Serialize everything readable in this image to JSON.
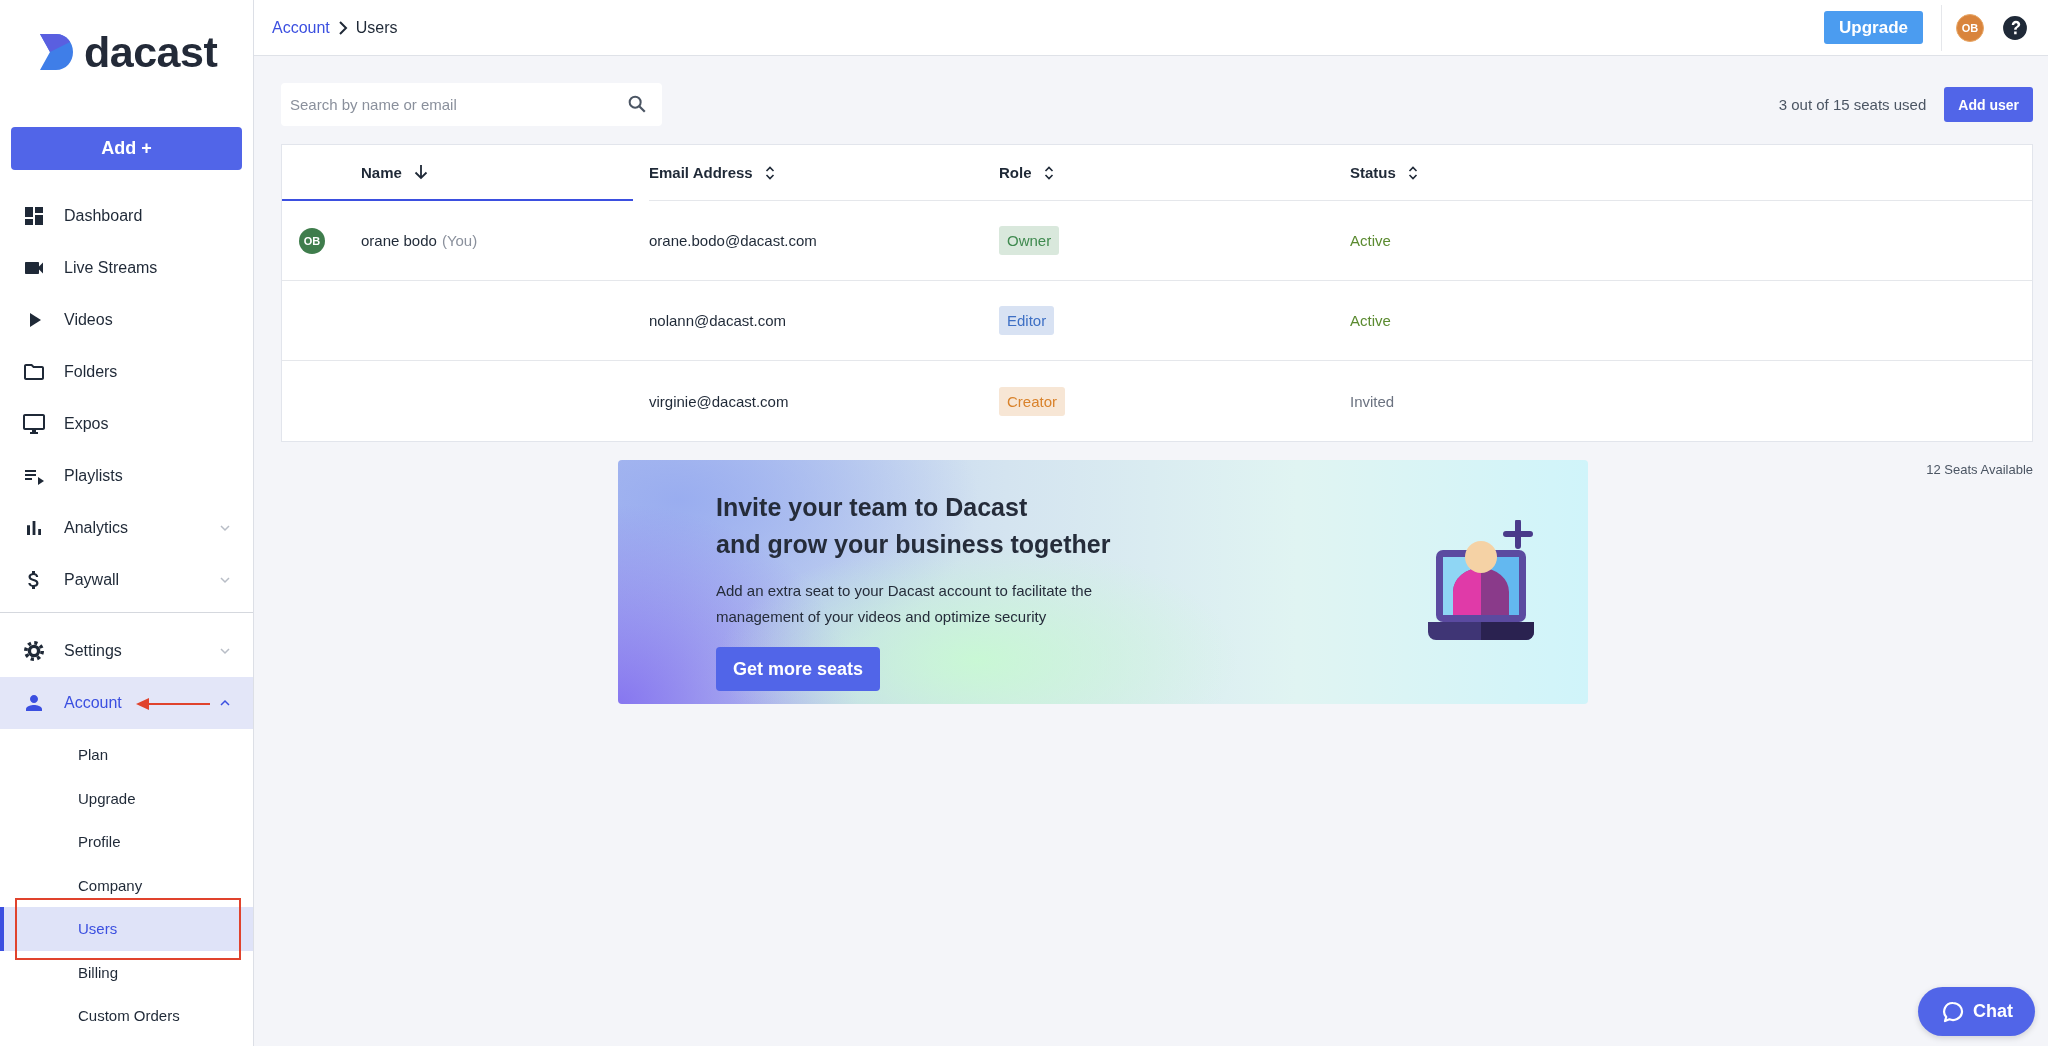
{
  "sidebar": {
    "logo": "dacast",
    "add_button": "Add +",
    "items": [
      {
        "label": "Dashboard",
        "selected": false
      },
      {
        "label": "Live Streams",
        "selected": false
      },
      {
        "label": "Videos",
        "selected": false
      },
      {
        "label": "Folders",
        "selected": false
      },
      {
        "label": "Expos",
        "selected": false
      },
      {
        "label": "Playlists",
        "selected": false
      },
      {
        "label": "Analytics",
        "selected": false,
        "expanded": false
      },
      {
        "label": "Paywall",
        "selected": false,
        "expanded": false
      }
    ],
    "bottom_items": [
      {
        "label": "Settings",
        "selected": false,
        "expanded": false
      },
      {
        "label": "Account",
        "selected": true,
        "expanded": true,
        "children": [
          {
            "label": "Plan",
            "selected": false
          },
          {
            "label": "Upgrade",
            "selected": false
          },
          {
            "label": "Profile",
            "selected": false
          },
          {
            "label": "Company",
            "selected": false
          },
          {
            "label": "Users",
            "selected": true
          },
          {
            "label": "Billing",
            "selected": false
          },
          {
            "label": "Custom Orders",
            "selected": false
          }
        ]
      }
    ]
  },
  "annotations": {
    "arrow": true,
    "frame": true
  },
  "header": {
    "breadcrumb": [
      "Account",
      "Users"
    ],
    "upgrade_button": "Upgrade",
    "avatar": "OB"
  },
  "toolbar": {
    "search": {
      "placeholder": "Search by name or email"
    },
    "seats_used": "3 out of 15 seats used",
    "add_button": "Add user"
  },
  "table": {
    "columns": [
      {
        "label": "Name",
        "sorted": true
      },
      {
        "label": "Email Address",
        "sorted": false
      },
      {
        "label": "Role",
        "sorted": false
      },
      {
        "label": "Status",
        "sorted": false
      }
    ],
    "rows": [
      {
        "avatar": "OB",
        "name": "orane bodo",
        "name_note": "(You)",
        "email": "orane.bodo@dacast.com",
        "role": {
          "text": "Owner",
          "color": "#3f8a4f"
        },
        "status": {
          "text": "Active",
          "color": "#5a8a2f"
        }
      },
      {
        "email": "nolann@dacast.com",
        "role": {
          "text": "Editor",
          "color": "#3d6fc4"
        },
        "status": {
          "text": "Active",
          "color": "#5a8a2f"
        }
      },
      {
        "email": "virginie@dacast.com",
        "role": {
          "text": "Creator",
          "color": "#d9822b"
        },
        "status": {
          "text": "Invited",
          "color": "#6b7280"
        }
      }
    ]
  },
  "seats_available": "12 Seats Available",
  "banner": {
    "title_lines": [
      "Invite your team to Dacast",
      "and grow your business together"
    ],
    "description_lines": [
      "Add an extra seat to your Dacast account to facilitate the",
      "management of your videos and optimize security"
    ],
    "button": "Get more seats"
  },
  "chat_button": "Chat"
}
